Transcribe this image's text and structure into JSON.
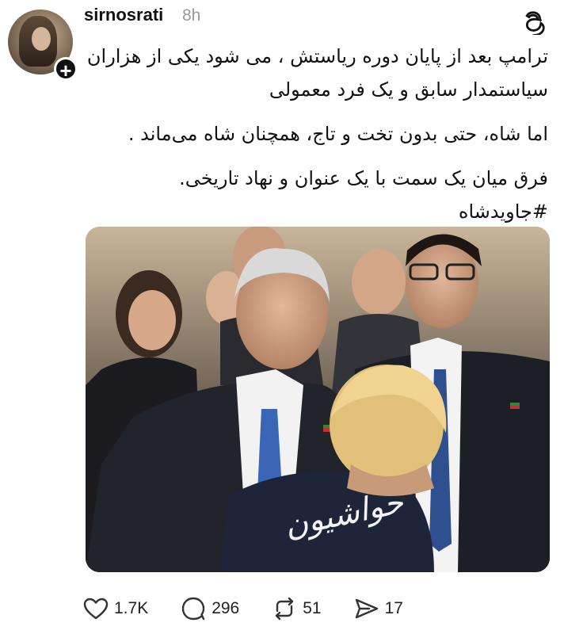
{
  "post": {
    "username": "sirnosrati",
    "timestamp": "8h",
    "follow_symbol": "+",
    "paragraphs": [
      "ترامپ  بعد از پایان دوره ریاستش ، می شود یکی از هزاران سیاستمدار سابق و یک فرد معمولی",
      "اما شاه، حتی بدون تخت و تاج، همچنان شاه می‌ماند .",
      "فرق میان یک سمت  با یک عنوان و نهاد تاریخی.",
      "#جاویدشاه"
    ],
    "image_watermark": "حواشیون"
  },
  "actions": {
    "likes": "1.7K",
    "comments": "296",
    "reposts": "51",
    "shares": "17"
  },
  "icons": {
    "app_logo": "threads-icon",
    "like": "heart-icon",
    "comment": "comment-bubble-icon",
    "repost": "repost-icon",
    "share": "send-icon"
  }
}
